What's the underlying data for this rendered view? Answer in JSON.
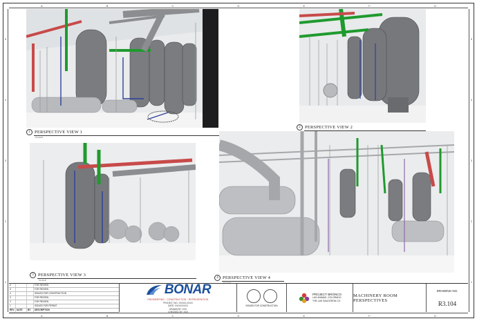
{
  "rulers": {
    "top": [
      "A",
      "B",
      "C",
      "D",
      "E",
      "F",
      "G"
    ],
    "left": [
      "5",
      "4",
      "3",
      "2",
      "1"
    ],
    "right": [
      "5",
      "4",
      "3",
      "2",
      "1"
    ]
  },
  "views": [
    {
      "num": "1",
      "title": "PERSPECTIVE VIEW 1",
      "scale": "SCALE"
    },
    {
      "num": "2",
      "title": "PERSPECTIVE VIEW 2",
      "scale": "SCALE"
    },
    {
      "num": "3",
      "title": "PERSPECTIVE VIEW 3",
      "scale": "SCALE"
    },
    {
      "num": "4",
      "title": "PERSPECTIVE VIEW 4",
      "scale": "SCALE"
    }
  ],
  "revisions": {
    "header": [
      "REV.",
      "DATE",
      "BY",
      "DESCRIPTION"
    ],
    "rows": [
      [
        "6",
        "",
        "",
        "FOR REVIEW"
      ],
      [
        "5",
        "",
        "",
        "FOR REVIEW"
      ],
      [
        "4",
        "",
        "",
        "ISSUED FOR CONSTRUCTION"
      ],
      [
        "3",
        "",
        "",
        "FOR REVIEW"
      ],
      [
        "2",
        "",
        "",
        "FOR REVIEW"
      ],
      [
        "1",
        "",
        "",
        "ISSUED FOR PERMIT"
      ]
    ]
  },
  "company": {
    "name": "BONAR",
    "tagline": "ENGINEERING · CONSTRUCTION · REFRIGERATION",
    "address": [
      "PROJECT NO. XXXXX-XXXX",
      "DATE: XX/XX/XXXX",
      "DRAWN BY: XXX",
      "CHECKED BY: XXX"
    ]
  },
  "stamps": {
    "caption": "ISSUED FOR CONSTRUCTION"
  },
  "client": {
    "project": "PROJECT BRONCO",
    "location": "LAS ANIMAS, COLORADO",
    "company": "THE LAS SAUCERON CO"
  },
  "sheet_title": "MACHINERY ROOM PERSPECTIVES",
  "drawing": {
    "label": "DRAWING NO.",
    "number": "R3.104"
  },
  "colors": {
    "brand": "#1b4f9c",
    "pipe_green": "#1f9a2e",
    "pipe_red": "#c84a4a",
    "pipe_blue": "#2c3f9a",
    "vessel": "#6e6f72"
  }
}
